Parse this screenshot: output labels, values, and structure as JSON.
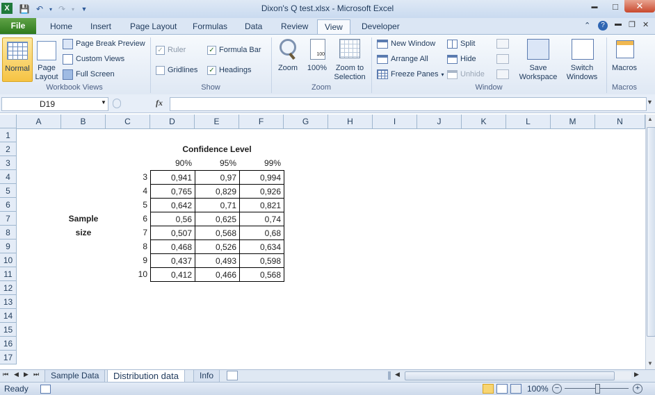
{
  "window": {
    "title": "Dixon's Q test.xlsx - Microsoft Excel",
    "minimize": "▬",
    "maximize": "□",
    "close": "✕"
  },
  "tabs": {
    "file": "File",
    "home": "Home",
    "insert": "Insert",
    "page_layout": "Page Layout",
    "formulas": "Formulas",
    "data": "Data",
    "review": "Review",
    "view": "View",
    "developer": "Developer"
  },
  "ribbon": {
    "workbook_views": {
      "normal": "Normal",
      "page_layout": "Page Layout",
      "page_break_preview": "Page Break Preview",
      "custom_views": "Custom Views",
      "full_screen": "Full Screen",
      "label": "Workbook Views"
    },
    "show": {
      "ruler": "Ruler",
      "formula_bar": "Formula Bar",
      "gridlines": "Gridlines",
      "headings": "Headings",
      "label": "Show"
    },
    "zoom": {
      "zoom": "Zoom",
      "hundred": "100%",
      "zoom_to_selection": "Zoom to Selection",
      "label": "Zoom"
    },
    "window": {
      "new_window": "New Window",
      "arrange_all": "Arrange All",
      "freeze_panes": "Freeze Panes",
      "split": "Split",
      "hide": "Hide",
      "unhide": "Unhide",
      "save_workspace": "Save Workspace",
      "switch_windows": "Switch Windows",
      "label": "Window"
    },
    "macros": {
      "macros": "Macros",
      "label": "Macros"
    }
  },
  "formula_bar": {
    "name_box": "D19",
    "fx": "fx",
    "value": ""
  },
  "columns": [
    "A",
    "B",
    "C",
    "D",
    "E",
    "F",
    "G",
    "H",
    "I",
    "J",
    "K",
    "L",
    "M",
    "N"
  ],
  "rows": [
    "1",
    "2",
    "3",
    "4",
    "5",
    "6",
    "7",
    "8",
    "9",
    "10",
    "11",
    "12",
    "13",
    "14",
    "15",
    "16",
    "17"
  ],
  "sheet": {
    "header": "Confidence Level",
    "levels": [
      "90%",
      "95%",
      "99%"
    ],
    "sample_label_1": "Sample",
    "sample_label_2": "size",
    "table": [
      [
        "3",
        "0,941",
        "0,97",
        "0,994"
      ],
      [
        "4",
        "0,765",
        "0,829",
        "0,926"
      ],
      [
        "5",
        "0,642",
        "0,71",
        "0,821"
      ],
      [
        "6",
        "0,56",
        "0,625",
        "0,74"
      ],
      [
        "7",
        "0,507",
        "0,568",
        "0,68"
      ],
      [
        "8",
        "0,468",
        "0,526",
        "0,634"
      ],
      [
        "9",
        "0,437",
        "0,493",
        "0,598"
      ],
      [
        "10",
        "0,412",
        "0,466",
        "0,568"
      ]
    ]
  },
  "sheet_tabs": [
    "Sample Data",
    "Distribution data",
    "Info"
  ],
  "status": {
    "ready": "Ready",
    "zoom": "100%"
  },
  "colors": {
    "file_tab": "#3c8a2a",
    "ribbon_bg": "#dfe8f4",
    "header_bg": "#e4ecf7"
  }
}
